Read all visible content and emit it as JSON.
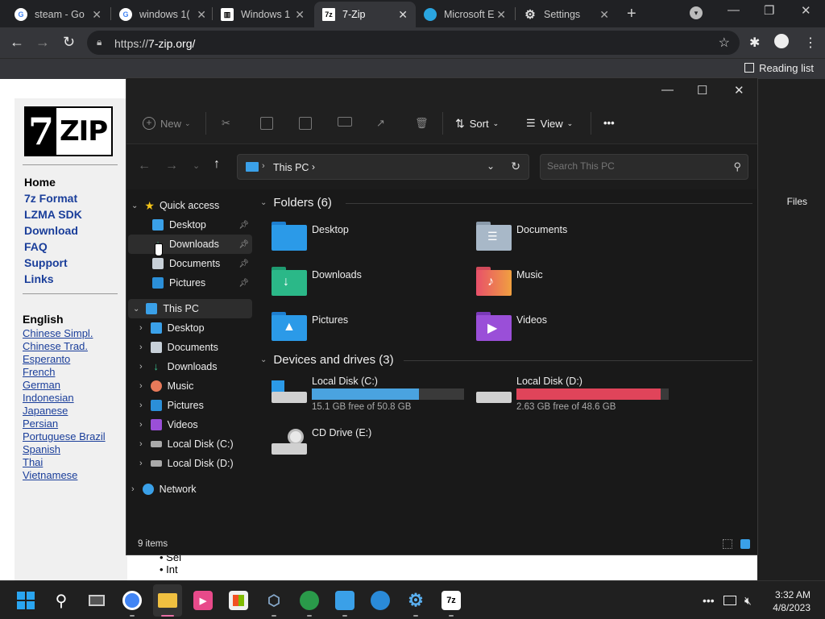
{
  "browser": {
    "tabs": [
      {
        "title": "steam - Go",
        "favicon": "google-icon",
        "color": "#ffffff"
      },
      {
        "title": "windows 1(",
        "favicon": "google-icon",
        "color": "#ffffff"
      },
      {
        "title": "Windows 1",
        "favicon": "library-icon",
        "color": "#ffffff"
      },
      {
        "title": "7-Zip",
        "favicon": "7zip-icon",
        "color": "#ffffff"
      },
      {
        "title": "Microsoft E",
        "favicon": "edge-icon",
        "color": "#2aa5e0"
      },
      {
        "title": "Settings",
        "favicon": "gear-icon",
        "color": "#ffffff"
      }
    ],
    "url_prefix": "https://",
    "url_host": "7-zip.org/",
    "reading_list": "Reading list"
  },
  "website": {
    "logo_digit": "7",
    "logo_text": "ZIP",
    "nav": [
      "Home",
      "7z Format",
      "LZMA SDK",
      "Download",
      "FAQ",
      "Support",
      "Links"
    ],
    "lang_header": "English",
    "languages": [
      "Chinese Simpl.",
      "Chinese Trad.",
      "Esperanto",
      "French",
      "German",
      "Indonesian",
      "Japanese",
      "Persian",
      "Portuguese Brazil",
      "Spanish",
      "Thai",
      "Vietnamese"
    ],
    "files_label": "Files",
    "bullets": [
      "Sel",
      "Int"
    ]
  },
  "explorer": {
    "commands": {
      "new": "New",
      "sort": "Sort",
      "view": "View",
      "more": "•••"
    },
    "address": "This PC",
    "search_placeholder": "Search This PC",
    "nav": {
      "quick_access": "Quick access",
      "quick_items": [
        "Desktop",
        "Downloads",
        "Documents",
        "Pictures"
      ],
      "this_pc": "This PC",
      "pc_items": [
        "Desktop",
        "Documents",
        "Downloads",
        "Music",
        "Pictures",
        "Videos",
        "Local Disk (C:)",
        "Local Disk (D:)"
      ],
      "network": "Network"
    },
    "folders_header": "Folders (6)",
    "folders": [
      "Desktop",
      "Documents",
      "Downloads",
      "Music",
      "Pictures",
      "Videos"
    ],
    "drives_header": "Devices and drives (3)",
    "drives": [
      {
        "name": "Local Disk (C:)",
        "space": "15.1 GB free of 50.8 GB",
        "used_fraction": 0.703,
        "color": "#4aa3e0"
      },
      {
        "name": "Local Disk (D:)",
        "space": "2.63 GB free of 48.6 GB",
        "used_fraction": 0.946,
        "color": "#e0445a"
      },
      {
        "name": "CD Drive (E:)"
      }
    ],
    "status": "9 items"
  },
  "taskbar": {
    "time": "3:32 AM",
    "date": "4/8/2023",
    "apps": [
      "start-icon",
      "search-icon",
      "task-view-icon",
      "chrome-icon",
      "file-explorer-icon",
      "media-player-icon",
      "store-icon",
      "virtualbox-icon",
      "network-tool-icon",
      "remote-desktop-icon",
      "globe-icon",
      "settings-icon",
      "7zip-icon"
    ]
  }
}
